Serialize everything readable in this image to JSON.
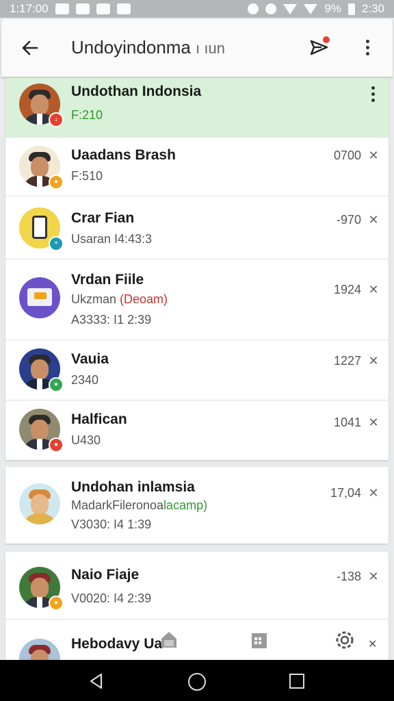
{
  "status_bar": {
    "time": "1:17:00",
    "battery": "9%",
    "clock_right": "2:30",
    "icons": [
      "notification-icon",
      "camera-icon",
      "lock-icon",
      "mail-icon",
      "nfc-icon",
      "alarm-icon",
      "wifi-icon",
      "signal-icon",
      "battery-icon"
    ]
  },
  "app_bar": {
    "title": "Undoyindonma",
    "title_suffix": "ı ıun",
    "back_icon": "arrow-left-icon",
    "send_icon": "send-icon",
    "more_icon": "more-vert-icon"
  },
  "colors": {
    "highlight": "#d9f1d8",
    "accent_green": "#2e9a2e",
    "accent_red": "#c2322c",
    "badge_red": "#e0432f",
    "badge_orange": "#f2a21b",
    "badge_teal": "#1a9bb0",
    "badge_green": "#2fa84f"
  },
  "conversations": [
    {
      "name": "Undothan Indonsia",
      "sub": "F:210",
      "meta": "",
      "highlighted": true,
      "badge": "badge_red",
      "avatar_bg": "#b35a2a"
    },
    {
      "name": "Uaadans Brash",
      "sub": "F:510",
      "meta": "0700",
      "highlighted": false,
      "badge": "badge_orange",
      "avatar_bg": "#f1e9d6"
    },
    {
      "name": "Crar Fian",
      "sub": "Usaran I4:43:3",
      "meta": "-970",
      "highlighted": false,
      "badge": "badge_teal",
      "avatar_bg": "#f2d64a"
    },
    {
      "name": "Vrdan Fiile",
      "sub_plain": "Ukzman ",
      "sub_red": "(Deoam)",
      "sub2": "A3333: I1 2:39",
      "meta": "1924",
      "highlighted": false,
      "badge": "",
      "avatar_bg": "#6c52c9"
    },
    {
      "name": "Vauia",
      "sub": "2340",
      "meta": "1227",
      "highlighted": false,
      "badge": "badge_green",
      "avatar_bg": "#2b3f8f"
    },
    {
      "name": "Halfican",
      "sub": "U430",
      "meta": "1041",
      "highlighted": false,
      "badge": "badge_red",
      "avatar_bg": "#8f8a70"
    }
  ],
  "card2": [
    {
      "name": "Undohan inlamsia",
      "sub_plain": "MadarkFileronoa",
      "sub_green": "lacamp)",
      "sub2": "V3030: I4 1:39",
      "meta": "17,04",
      "avatar_bg": "#cfe8ee"
    }
  ],
  "card3": [
    {
      "name": "Naio Fiaje",
      "sub": "V0020: I4 2:39",
      "meta": "-138",
      "badge": "badge_orange",
      "avatar_bg": "#3f7a3a"
    },
    {
      "name": "Hebodavy Ua",
      "avatar_bg": "#a9c3d9"
    }
  ],
  "bottom_icons": [
    "home-icon",
    "calendar-icon",
    "settings-icon",
    "close-icon"
  ],
  "nav": {
    "back": "nav-back-icon",
    "home": "nav-home-icon",
    "recent": "nav-recent-icon"
  }
}
